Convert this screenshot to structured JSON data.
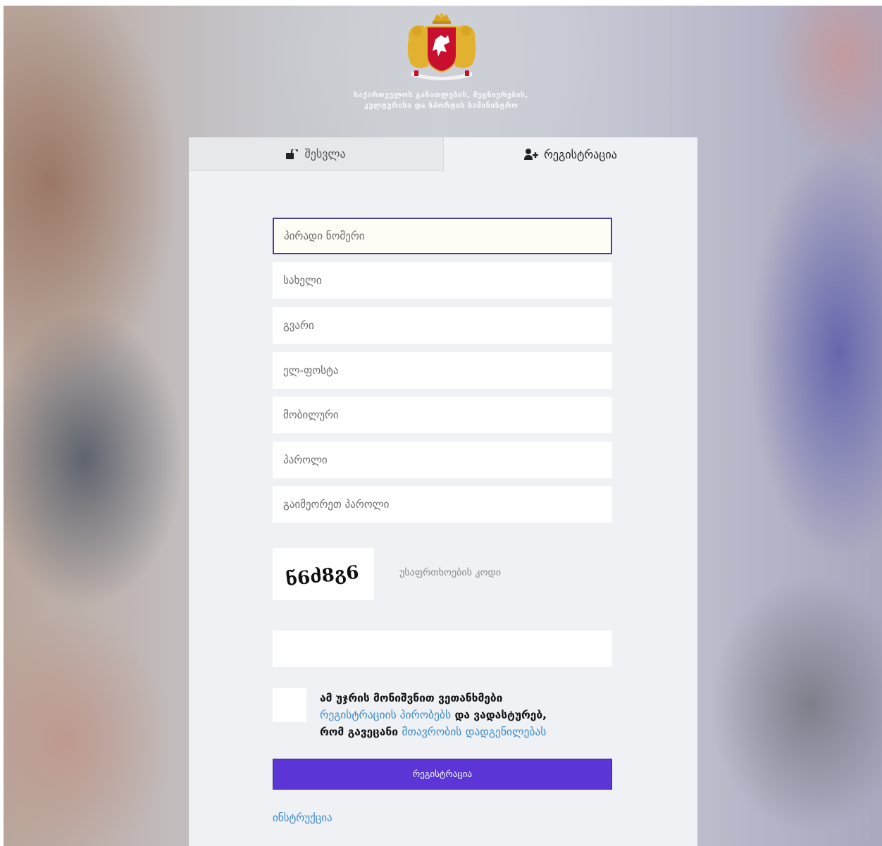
{
  "header": {
    "ministry_name": "საქართველოს განათლების, მეცნიერების, კულტურისა და სპორტის სამინისტრო",
    "emblem_icon": "georgia-coat-of-arms"
  },
  "tabs": {
    "login": {
      "label": "შესვლა",
      "icon": "login-icon"
    },
    "register": {
      "label": "რეგისტრაცია",
      "icon": "add-user-icon",
      "active": true
    }
  },
  "form": {
    "personal_number_placeholder": "პირადი ნომერი",
    "first_name_placeholder": "სახელი",
    "last_name_placeholder": "გვარი",
    "email_placeholder": "ელ-ფოსტა",
    "mobile_placeholder": "მობილური",
    "password_placeholder": "პაროლი",
    "repeat_password_placeholder": "გაიმეორეთ პაროლი",
    "captcha_text": "ნ6ძ8გ6",
    "captcha_label": "უსაფრთხოების კოდი",
    "captcha_value": ""
  },
  "agreement": {
    "text_1": "ამ უჯრის მონიშვნით ვეთანხმები",
    "link_terms": "რეგისტრაციის პირობებს",
    "text_2": "და ვადასტურებ,",
    "text_3": "რომ გავეცანი",
    "link_government": "მთავრობის",
    "link_resolution": "დადგენილებას"
  },
  "submit_label": "რეგისტრაცია",
  "instructions_link": "ინსტრუქცია",
  "colors": {
    "accent": "#5b35d5",
    "link": "#3a89c9",
    "panel": "#eff1f5"
  }
}
